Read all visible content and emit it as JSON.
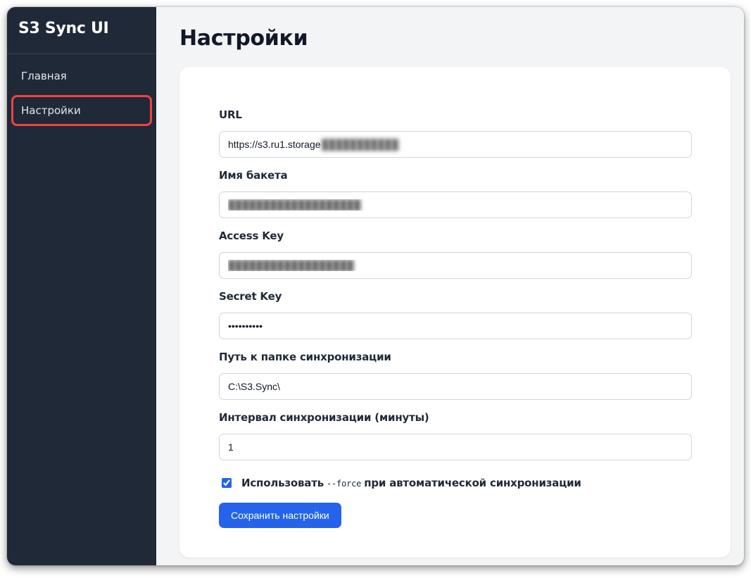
{
  "app": {
    "title": "S3 Sync UI"
  },
  "sidebar": {
    "items": [
      {
        "label": "Главная",
        "active": false
      },
      {
        "label": "Настройки",
        "active": true
      }
    ]
  },
  "page": {
    "title": "Настройки"
  },
  "form": {
    "url": {
      "label": "URL",
      "value": "https://s3.ru1.storage",
      "blurred_suffix": "███████████"
    },
    "bucket": {
      "label": "Имя бакета",
      "value": "███████████████████"
    },
    "access_key": {
      "label": "Access Key",
      "value": "██████████████████"
    },
    "secret_key": {
      "label": "Secret Key",
      "value": "••••••••••"
    },
    "sync_path": {
      "label": "Путь к папке синхронизации",
      "value": "C:\\S3.Sync\\"
    },
    "interval": {
      "label": "Интервал синхронизации (минуты)",
      "value": "1"
    },
    "force_checkbox": {
      "prefix": "Использовать",
      "code": "--force",
      "suffix": "при автоматической синхронизации",
      "checked": true
    },
    "save_label": "Сохранить настройки"
  },
  "colors": {
    "sidebar_bg": "#1f2937",
    "accent": "#2563eb",
    "highlight_outline": "#ef4444",
    "page_bg": "#f3f4f6"
  }
}
